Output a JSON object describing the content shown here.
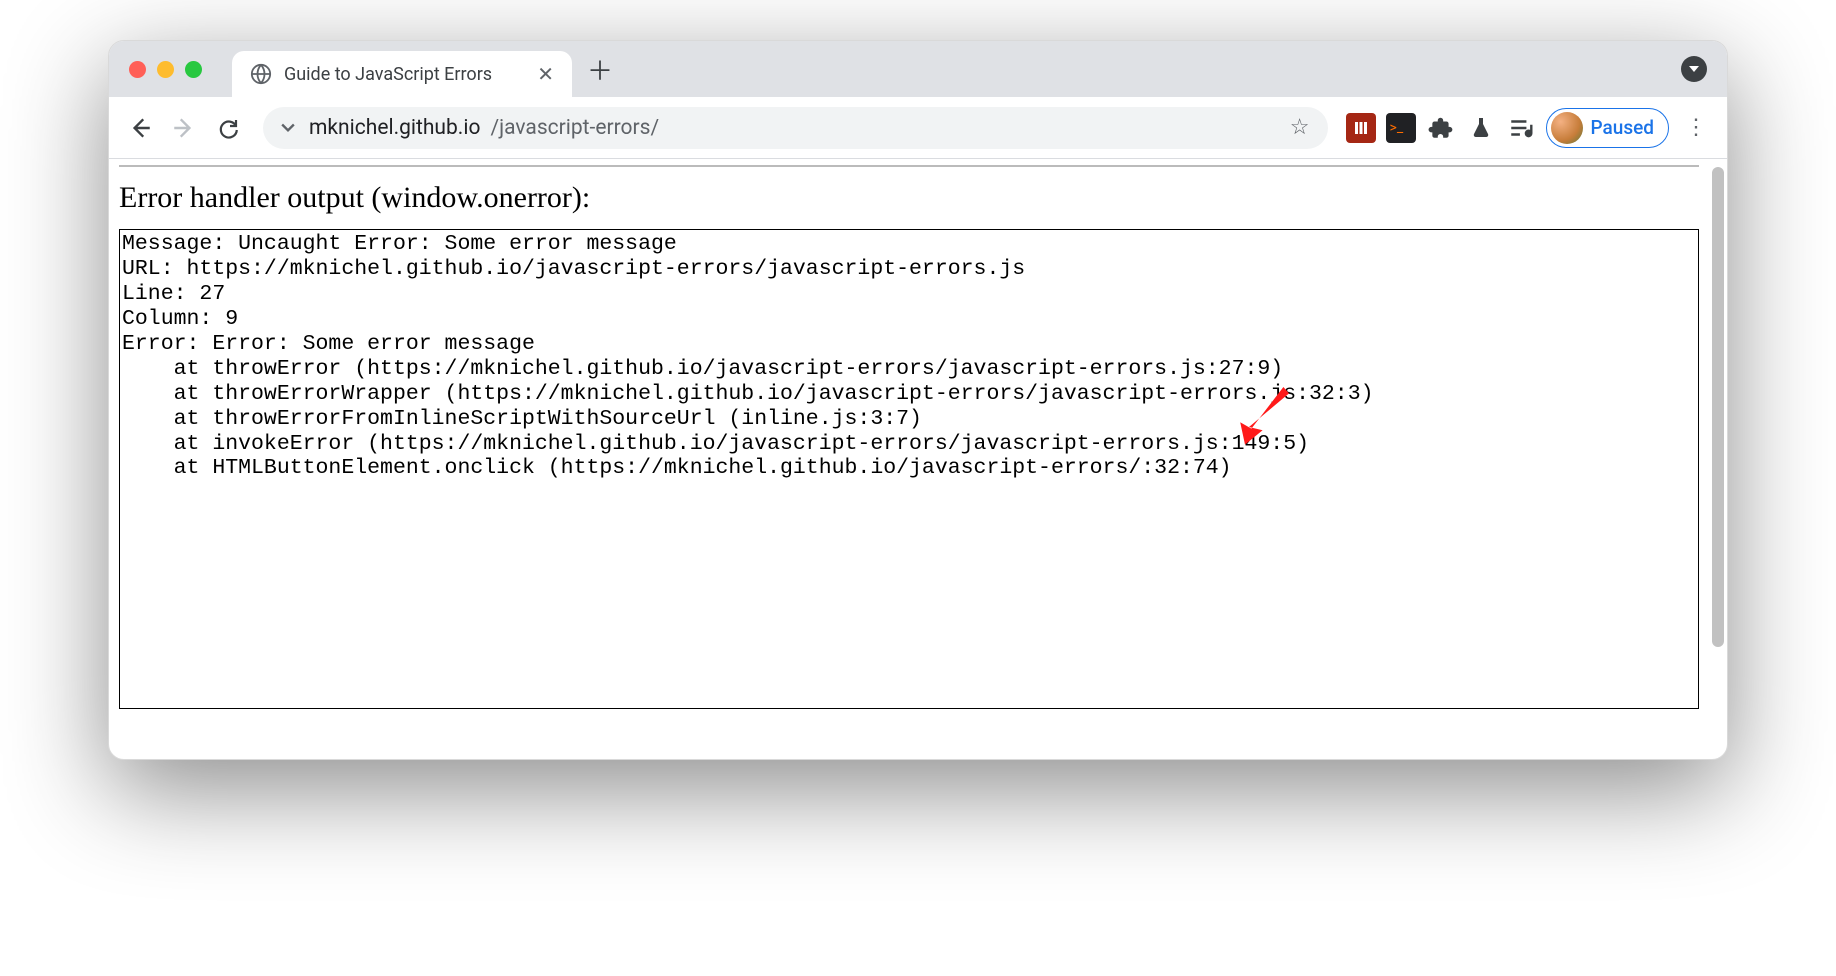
{
  "tab": {
    "title": "Guide to JavaScript Errors"
  },
  "omnibox": {
    "host": "mknichel.github.io",
    "path": "/javascript-errors/"
  },
  "profile": {
    "status": "Paused"
  },
  "page": {
    "heading": "Error handler output (window.onerror):",
    "error_lines": [
      "Message: Uncaught Error: Some error message",
      "URL: https://mknichel.github.io/javascript-errors/javascript-errors.js",
      "Line: 27",
      "Column: 9",
      "Error: Error: Some error message",
      "    at throwError (https://mknichel.github.io/javascript-errors/javascript-errors.js:27:9)",
      "    at throwErrorWrapper (https://mknichel.github.io/javascript-errors/javascript-errors.js:32:3)",
      "    at throwErrorFromInlineScriptWithSourceUrl (inline.js:3:7)",
      "    at invokeError (https://mknichel.github.io/javascript-errors/javascript-errors.js:149:5)",
      "    at HTMLButtonElement.onclick (https://mknichel.github.io/javascript-errors/:32:74)"
    ]
  }
}
